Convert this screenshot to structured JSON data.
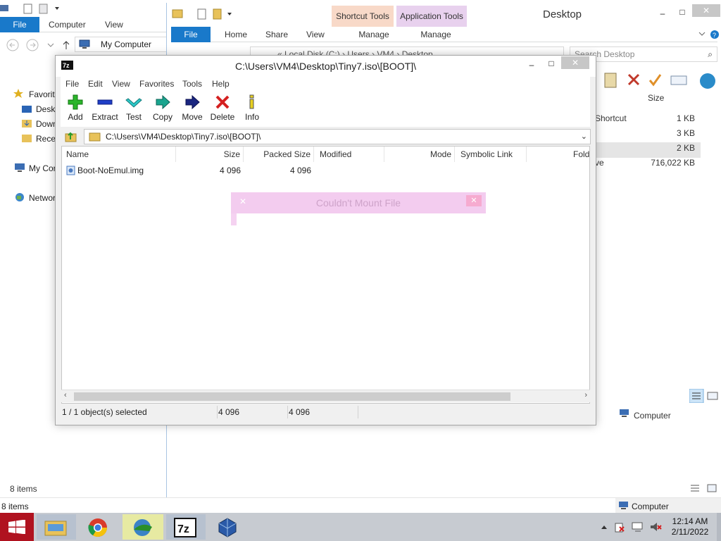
{
  "back_explorer": {
    "tabs": [
      "File",
      "Computer",
      "View"
    ],
    "address": "My Computer",
    "tree": [
      "Favorit",
      "Deskt",
      "Down",
      "Recer",
      "My Cor",
      "Networ"
    ],
    "status": "8 items",
    "bottom_status": "8 items"
  },
  "front_explorer": {
    "title": "Desktop",
    "context_tabs": [
      "Shortcut Tools",
      "Application Tools"
    ],
    "tabs": [
      "File",
      "Home",
      "Share",
      "View"
    ],
    "context_manage": [
      "Manage",
      "Manage"
    ],
    "address": "« Local Disk (C:) › Users › VM4 › Desktop",
    "search_placeholder": "Search Desktop",
    "col_size": "Size",
    "rows": [
      {
        "type": "Shortcut",
        "size": "1 KB"
      },
      {
        "type": "",
        "size": "3 KB"
      },
      {
        "type": "",
        "size": "2 KB"
      },
      {
        "type": "ve",
        "size": "716,022 KB"
      }
    ],
    "status_location": "Computer",
    "bottom_location": "Computer"
  },
  "sevenzip": {
    "title": "C:\\Users\\VM4\\Desktop\\Tiny7.iso\\[BOOT]\\",
    "menu": [
      "File",
      "Edit",
      "View",
      "Favorites",
      "Tools",
      "Help"
    ],
    "toolbar": [
      "Add",
      "Extract",
      "Test",
      "Copy",
      "Move",
      "Delete",
      "Info"
    ],
    "path": "C:\\Users\\VM4\\Desktop\\Tiny7.iso\\[BOOT]\\",
    "columns": [
      "Name",
      "Size",
      "Packed Size",
      "Modified",
      "Mode",
      "Symbolic Link",
      "Folder"
    ],
    "files": [
      {
        "name": "Boot-NoEmul.img",
        "size": "4 096",
        "packed": "4 096"
      }
    ],
    "status": {
      "selected": "1 / 1 object(s) selected",
      "size": "4 096",
      "packed": "4 096"
    }
  },
  "dialog": {
    "title": "Couldn't Mount File"
  },
  "taskbar": {
    "time": "12:14 AM",
    "date": "2/11/2022"
  }
}
